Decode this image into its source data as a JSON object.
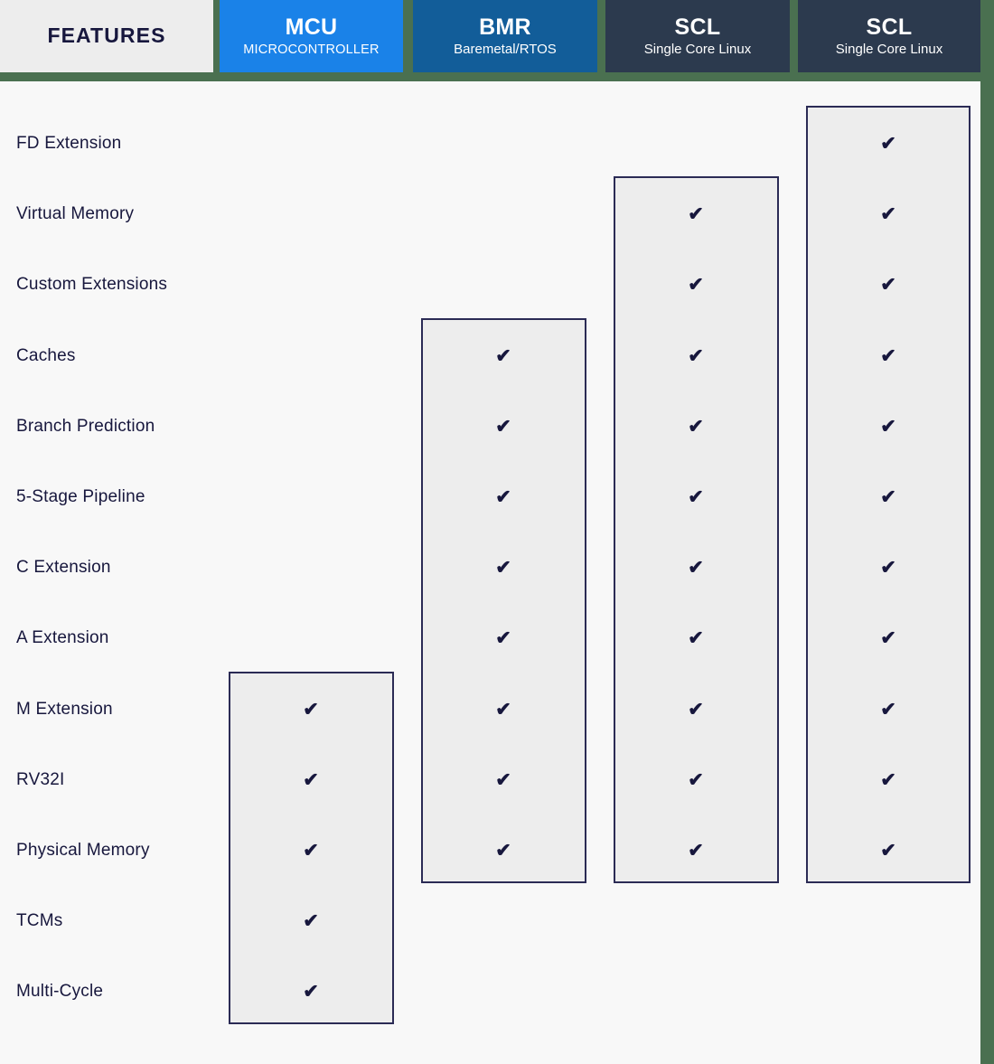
{
  "page": {
    "background_color": "#4a7050",
    "card_color": "#f8f8f8"
  },
  "header": {
    "features_label": "FEATURES",
    "columns": [
      {
        "abbr": "MCU",
        "subtitle": "MICROCONTROLLER",
        "color": "#1a82e8"
      },
      {
        "abbr": "BMR",
        "subtitle": "Baremetal/RTOS",
        "color": "#125d99"
      },
      {
        "abbr": "SCL",
        "subtitle": "Single Core Linux",
        "color": "#2c3a4e"
      },
      {
        "abbr": "SCL",
        "subtitle": "Single Core Linux",
        "color": "#2c3a4e"
      }
    ]
  },
  "table": {
    "check_glyph": "✔",
    "check_color": "#17173d",
    "band_fill": "#ededed",
    "band_border": "#2b2b55",
    "features": [
      {
        "label": "FD Extension",
        "support": [
          false,
          false,
          false,
          true
        ]
      },
      {
        "label": "Virtual Memory",
        "support": [
          false,
          false,
          true,
          true
        ]
      },
      {
        "label": "Custom Extensions",
        "support": [
          false,
          false,
          true,
          true
        ]
      },
      {
        "label": "Caches",
        "support": [
          false,
          true,
          true,
          true
        ]
      },
      {
        "label": "Branch Prediction",
        "support": [
          false,
          true,
          true,
          true
        ]
      },
      {
        "label": "5-Stage Pipeline",
        "support": [
          false,
          true,
          true,
          true
        ]
      },
      {
        "label": "C Extension",
        "support": [
          false,
          true,
          true,
          true
        ]
      },
      {
        "label": "A Extension",
        "support": [
          false,
          true,
          true,
          true
        ]
      },
      {
        "label": "M Extension",
        "support": [
          true,
          true,
          true,
          true
        ]
      },
      {
        "label": "RV32I",
        "support": [
          true,
          true,
          true,
          true
        ]
      },
      {
        "label": "Physical Memory",
        "support": [
          true,
          true,
          true,
          true
        ]
      },
      {
        "label": "TCMs",
        "support": [
          true,
          false,
          false,
          false
        ]
      },
      {
        "label": "Multi-Cycle",
        "support": [
          true,
          false,
          false,
          false
        ]
      }
    ]
  }
}
